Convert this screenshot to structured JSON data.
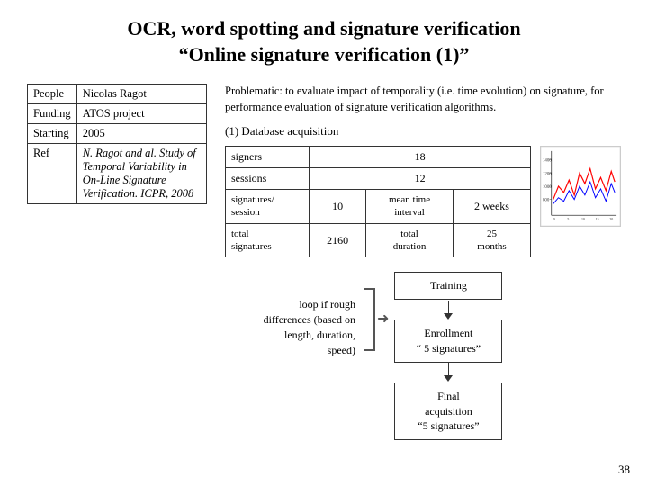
{
  "title": {
    "line1": "OCR, word spotting and signature verification",
    "line2": "“Online signature verification (1)”"
  },
  "info_table": {
    "rows": [
      {
        "label": "People",
        "value": "Nicolas Ragot"
      },
      {
        "label": "Funding",
        "value": "ATOS project"
      },
      {
        "label": "Starting",
        "value": "2005"
      },
      {
        "label": "Ref",
        "value": "N. Ragot and al. Study of Temporal Variability in On-Line Signature Verification. ICPR, 2008"
      }
    ]
  },
  "problematic": {
    "text": "Problematic: to evaluate impact of temporality (i.e. time evolution) on signature, for performance evaluation of signature verification algorithms."
  },
  "db_section": {
    "title": "(1) Database acquisition",
    "rows": [
      {
        "label": "signers",
        "value": "18"
      },
      {
        "label": "sessions",
        "value": "12"
      }
    ],
    "sub_rows": [
      {
        "col1": "signatures/\nsession",
        "col2": "10",
        "col3": "mean time\ninterval",
        "col4": "2 weeks"
      },
      {
        "col1": "total\nsignatures",
        "col2": "2160",
        "col3": "total\nduration",
        "col4": "25\nmonths"
      }
    ]
  },
  "flow": {
    "loop_text": "loop if rough\ndifferences (based on\nlength, duration,\nspeed)",
    "boxes": [
      {
        "text": "Training"
      },
      {
        "text": "Enrollment\n“ 5 signatures”"
      },
      {
        "text": "Final\nacquisition\n“5 signatures”"
      }
    ]
  },
  "page_number": "38"
}
